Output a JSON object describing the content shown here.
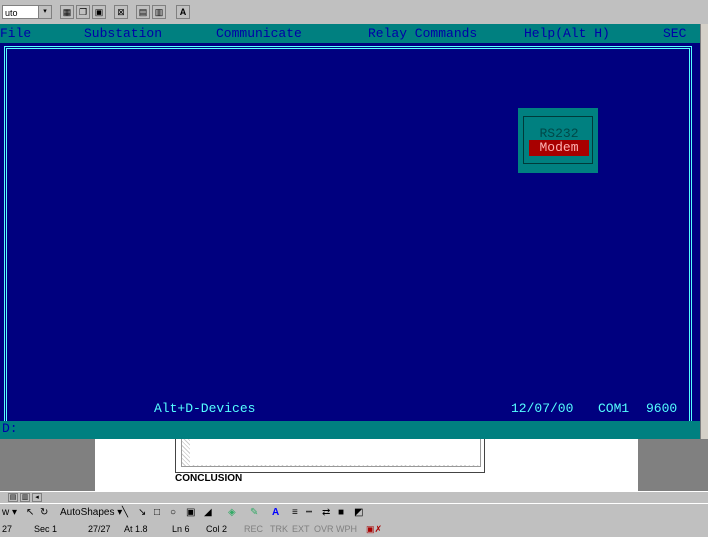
{
  "toolbar": {
    "font_select": "uto"
  },
  "terminal": {
    "menu": [
      "File",
      "Substation",
      "Communicate",
      "Relay Commands",
      "Help(Alt H)",
      "SEC"
    ],
    "hotkey": "Alt+D-Devices",
    "date": "12/07/00",
    "port": "COM1",
    "baud": "9600",
    "prompt": "D:"
  },
  "comm_popup": {
    "options": [
      "RS232",
      "Modem"
    ],
    "selected": "Modem"
  },
  "document": {
    "heading": "CONCLUSION"
  },
  "drawing_toolbar": {
    "draw": "w ▾",
    "autoshapes": "AutoShapes ▾"
  },
  "status_bar": {
    "page": "27",
    "sec": "Sec 1",
    "pages": "27/27",
    "at": "At 1.8",
    "ln": "Ln 6",
    "col": "Col 2",
    "modes": [
      "REC",
      "TRK",
      "EXT",
      "OVR",
      "WPH"
    ]
  },
  "colors": {
    "terminal_bg": "#00007f",
    "menu_bg": "#008080",
    "popup_highlight": "#a80000"
  }
}
